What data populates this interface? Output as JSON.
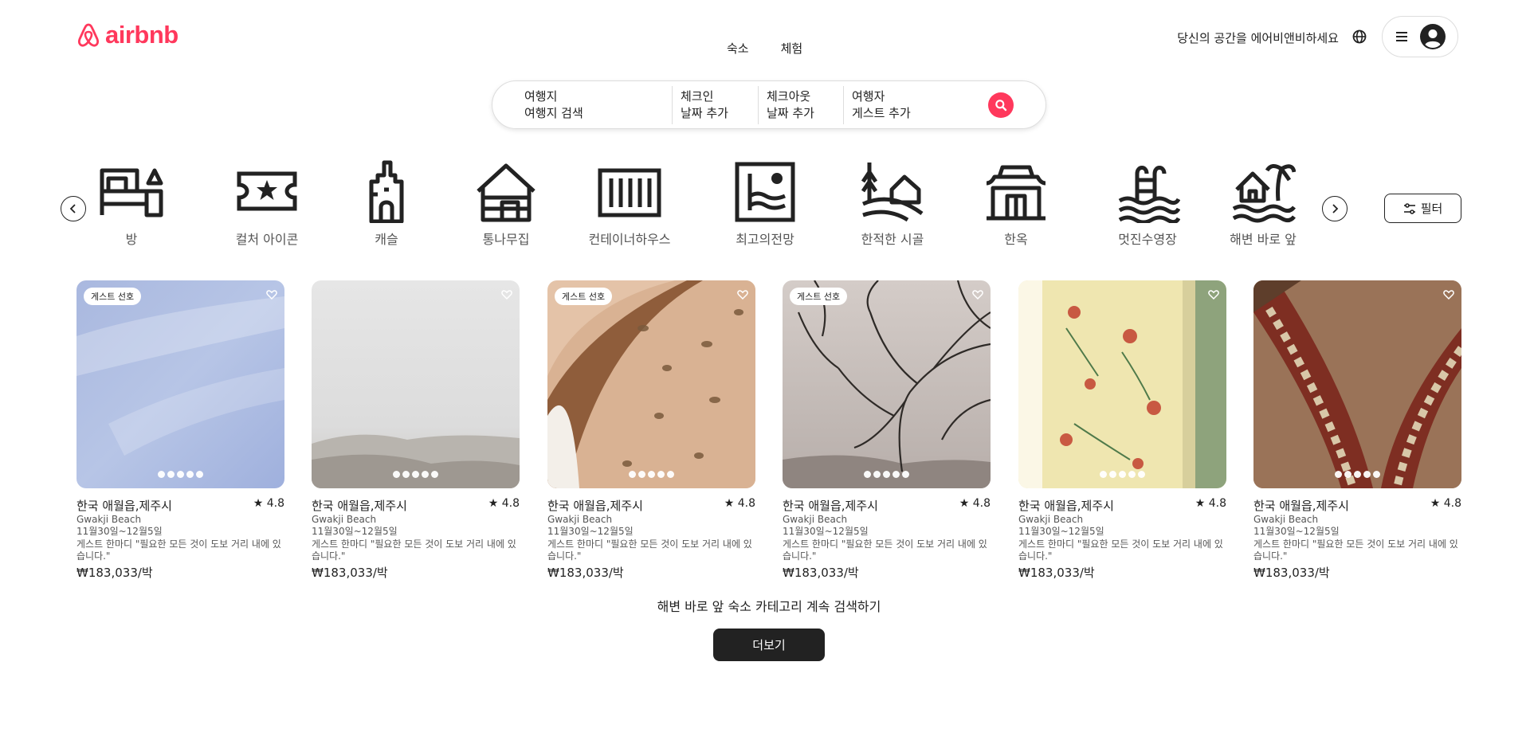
{
  "header": {
    "logo_text": "airbnb",
    "brand_color": "#ff385c",
    "tabs": [
      {
        "label": "숙소"
      },
      {
        "label": "체험"
      }
    ],
    "host_link": "당신의 공간을 에어비앤비하세요",
    "globe_icon": "globe-icon",
    "menu_icon": "hamburger-icon",
    "avatar_icon": "user-avatar-icon"
  },
  "search": {
    "location": {
      "label": "여행지",
      "placeholder": "여행지 검색"
    },
    "checkin": {
      "label": "체크인",
      "value": "날짜 추가"
    },
    "checkout": {
      "label": "체크아웃",
      "value": "날짜 추가"
    },
    "guests": {
      "label": "여행자",
      "value": "게스트 추가"
    },
    "button_icon": "search-icon"
  },
  "categories": [
    {
      "label": "방",
      "icon": "bed-icon"
    },
    {
      "label": "컬처 아이콘",
      "icon": "ticket-star-icon"
    },
    {
      "label": "캐슬",
      "icon": "castle-icon"
    },
    {
      "label": "통나무집",
      "icon": "log-cabin-icon"
    },
    {
      "label": "컨테이너하우스",
      "icon": "container-icon"
    },
    {
      "label": "최고의전망",
      "icon": "view-icon"
    },
    {
      "label": "한적한 시골",
      "icon": "countryside-icon"
    },
    {
      "label": "한옥",
      "icon": "hanok-icon"
    },
    {
      "label": "멋진수영장",
      "icon": "pool-icon"
    },
    {
      "label": "해변 바로 앞",
      "icon": "beachfront-icon"
    }
  ],
  "filter": {
    "label": "필터",
    "icon": "sliders-icon"
  },
  "listings": [
    {
      "badge": "게스트 선호",
      "title": "한국 애월읍,제주시",
      "rating": "4.8",
      "location": "Gwakji Beach",
      "dates": "11월30일~12월5일",
      "desc": "게스트 한마디 \"필요한 모든 것이 도보 거리 내에 있습니다.\"",
      "price": "₩183,033/박"
    },
    {
      "badge": "",
      "title": "한국 애월읍,제주시",
      "rating": "4.8",
      "location": "Gwakji Beach",
      "dates": "11월30일~12월5일",
      "desc": "게스트 한마디 \"필요한 모든 것이 도보 거리 내에 있습니다.\"",
      "price": "₩183,033/박"
    },
    {
      "badge": "게스트 선호",
      "title": "한국 애월읍,제주시",
      "rating": "4.8",
      "location": "Gwakji Beach",
      "dates": "11월30일~12월5일",
      "desc": "게스트 한마디 \"필요한 모든 것이 도보 거리 내에 있습니다.\"",
      "price": "₩183,033/박"
    },
    {
      "badge": "게스트 선호",
      "title": "한국 애월읍,제주시",
      "rating": "4.8",
      "location": "Gwakji Beach",
      "dates": "11월30일~12월5일",
      "desc": "게스트 한마디 \"필요한 모든 것이 도보 거리 내에 있습니다.\"",
      "price": "₩183,033/박"
    },
    {
      "badge": "",
      "title": "한국 애월읍,제주시",
      "rating": "4.8",
      "location": "Gwakji Beach",
      "dates": "11월30일~12월5일",
      "desc": "게스트 한마디 \"필요한 모든 것이 도보 거리 내에 있습니다.\"",
      "price": "₩183,033/박"
    },
    {
      "badge": "",
      "title": "한국 애월읍,제주시",
      "rating": "4.8",
      "location": "Gwakji Beach",
      "dates": "11월30일~12월5일",
      "desc": "게스트 한마디 \"필요한 모든 것이 도보 거리 내에 있습니다.\"",
      "price": "₩183,033/박"
    }
  ],
  "rating_star": "★",
  "more": {
    "text": "해변 바로 앞 숙소 카테고리 계속 검색하기",
    "button": "더보기"
  }
}
